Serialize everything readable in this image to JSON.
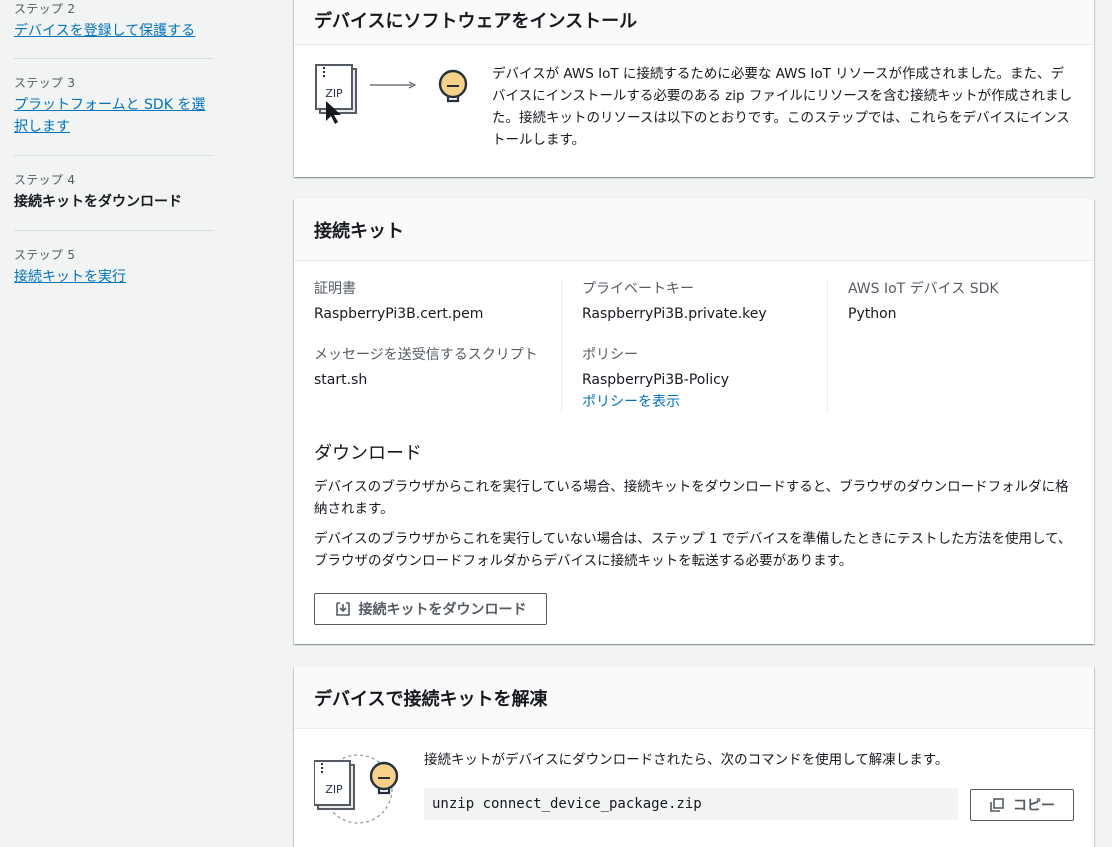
{
  "sidebar": {
    "steps": [
      {
        "label": "ステップ 2",
        "title": "デバイスを登録して保護する",
        "state": "link"
      },
      {
        "label": "ステップ 3",
        "title": "プラットフォームと SDK を選択します",
        "state": "link"
      },
      {
        "label": "ステップ 4",
        "title": "接続キットをダウンロード",
        "state": "current"
      },
      {
        "label": "ステップ 5",
        "title": "接続キットを実行",
        "state": "link"
      }
    ]
  },
  "install_panel": {
    "title": "デバイスにソフトウェアをインストール",
    "zip_label": "ZIP",
    "description": "デバイスが AWS IoT に接続するために必要な AWS IoT リソースが作成されました。また、デバイスにインストールする必要のある zip ファイルにリソースを含む接続キットが作成されました。接続キットのリソースは以下のとおりです。このステップでは、これらをデバイスにインストールします。"
  },
  "kit_panel": {
    "title": "接続キット",
    "certificate_label": "証明書",
    "certificate_value": "RaspberryPi3B.cert.pem",
    "script_label": "メッセージを送受信するスクリプト",
    "script_value": "start.sh",
    "private_key_label": "プライベートキー",
    "private_key_value": "RaspberryPi3B.private.key",
    "policy_label": "ポリシー",
    "policy_value": "RaspberryPi3B-Policy",
    "policy_link": "ポリシーを表示",
    "sdk_label": "AWS IoT デバイス SDK",
    "sdk_value": "Python",
    "download_title": "ダウンロード",
    "download_text_1": "デバイスのブラウザからこれを実行している場合、接続キットをダウンロードすると、ブラウザのダウンロードフォルダに格納されます。",
    "download_text_2": "デバイスのブラウザからこれを実行していない場合は、ステップ 1 でデバイスを準備したときにテストした方法を使用して、ブラウザのダウンロードフォルダからデバイスに接続キットを転送する必要があります。",
    "download_button": "接続キットをダウンロード"
  },
  "unzip_panel": {
    "title": "デバイスで接続キットを解凍",
    "zip_label": "ZIP",
    "instruction": "接続キットがデバイスにダウンロードされたら、次のコマンドを使用して解凍します。",
    "command": "unzip connect_device_package.zip",
    "copy_button": "コピー"
  },
  "colors": {
    "link": "#0073bb",
    "bulb": "#f7d08a",
    "background": "#f2f3f3"
  }
}
